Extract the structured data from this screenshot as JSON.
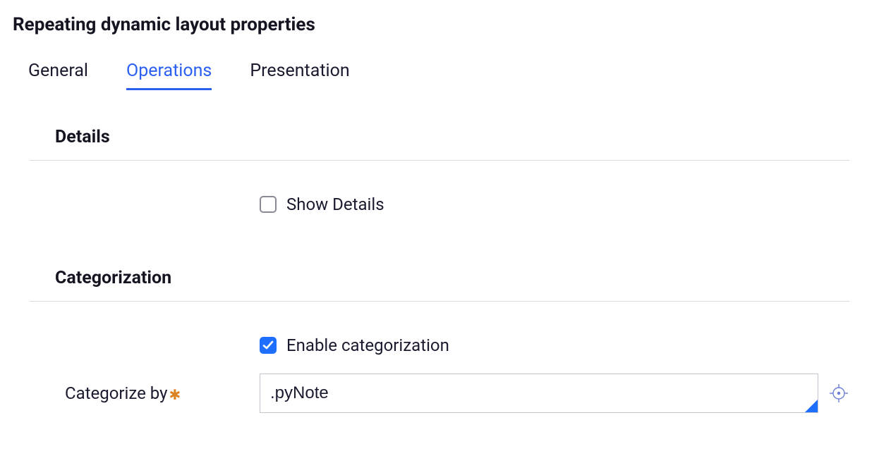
{
  "title": "Repeating dynamic layout properties",
  "tabs": {
    "general": "General",
    "operations": "Operations",
    "presentation": "Presentation"
  },
  "sections": {
    "details": {
      "heading": "Details",
      "show_details_label": "Show Details",
      "show_details_checked": false
    },
    "categorization": {
      "heading": "Categorization",
      "enable_label": "Enable categorization",
      "enable_checked": true,
      "categorize_by_label": "Categorize by",
      "categorize_by_value": ".pyNote"
    }
  }
}
